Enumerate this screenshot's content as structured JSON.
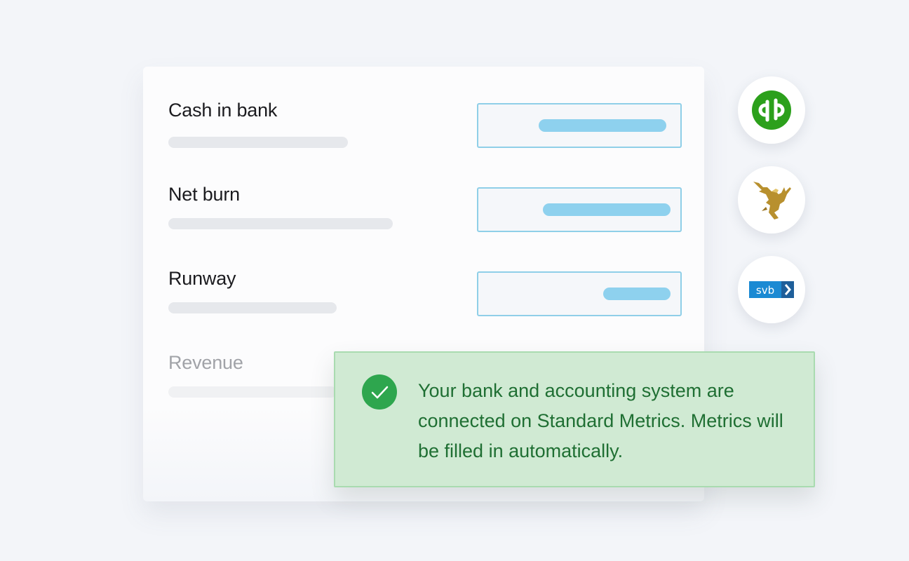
{
  "metrics": [
    {
      "label": "Cash in bank",
      "faded": false
    },
    {
      "label": "Net burn",
      "faded": false
    },
    {
      "label": "Runway",
      "faded": false
    },
    {
      "label": "Revenue",
      "faded": true
    }
  ],
  "integrations": [
    {
      "name": "quickbooks",
      "icon": "quickbooks-logo-icon",
      "color": "#2ca01c"
    },
    {
      "name": "eagle-bank",
      "icon": "eagle-logo-icon",
      "color": "#b8902e"
    },
    {
      "name": "svb",
      "icon": "svb-logo-icon",
      "text": "svb",
      "color": "#1b8ad3"
    }
  ],
  "notice": {
    "text": "Your bank and accounting system are connected on Standard Metrics. Metrics will be filled in automatically.",
    "icon": "check-circle-icon",
    "color": "#2ea64e"
  }
}
